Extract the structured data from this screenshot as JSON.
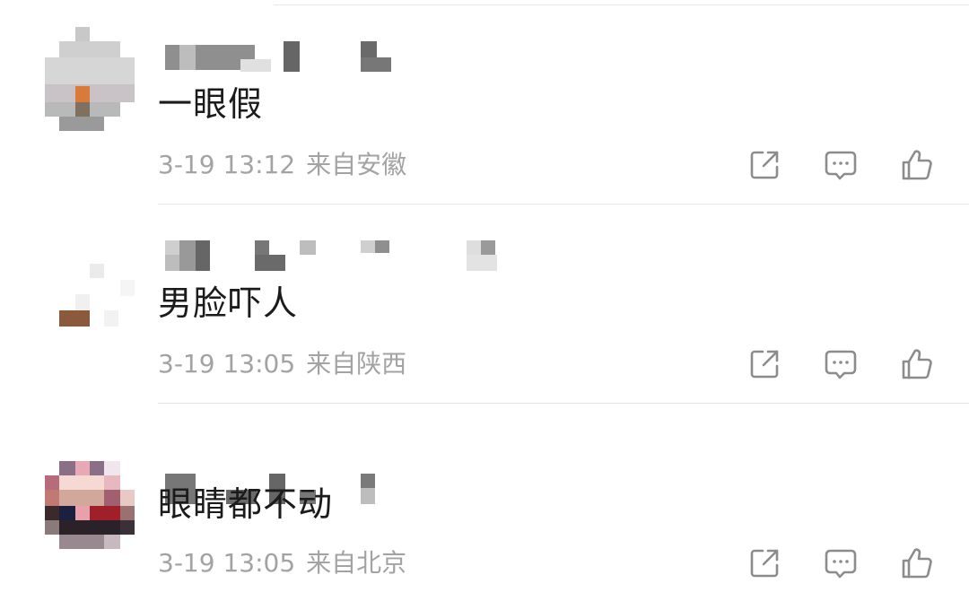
{
  "comments": [
    {
      "text": "一眼假",
      "time": "3-19 13:12",
      "location": "来自安徽",
      "avatar_colors": [
        "#bdbdbd",
        "#cfcfcf",
        "#e0e0e0",
        "#d97a3a",
        "#8a8a8a"
      ]
    },
    {
      "text": "男脸吓人",
      "time": "3-19 13:05",
      "location": "来自陕西",
      "avatar_colors": [
        "#e8e8e8",
        "#f3f3f3",
        "#8b5a3c",
        "#dcdcdc"
      ]
    },
    {
      "text": "眼睛都不动",
      "time": "3-19 13:05",
      "location": "来自北京",
      "avatar_colors": [
        "#8a6f86",
        "#e8a9b6",
        "#f6d9d2",
        "#c07a73",
        "#223",
        "#a0202a"
      ]
    }
  ],
  "icons": {
    "share": "share-icon",
    "reply": "comment-icon",
    "like": "thumbs-up-icon"
  },
  "colors": {
    "text": "#1b1b1b",
    "meta": "#a3a3a3",
    "icon": "#8c8c8c",
    "divider": "#e6e6e6"
  }
}
